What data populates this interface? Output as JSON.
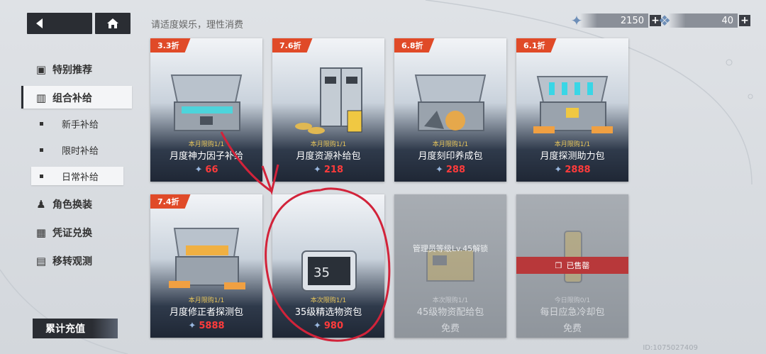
{
  "header": {
    "back_icon": "back-arrow-icon",
    "home_icon": "home-icon",
    "notice": "请适度娱乐，理性消费"
  },
  "currency": [
    {
      "icon": "crystal-gem-icon",
      "value": "2150",
      "plus": "+"
    },
    {
      "icon": "blue-gem-icon",
      "value": "40",
      "plus": "+"
    }
  ],
  "sidebar": {
    "items": [
      {
        "label": "特别推荐",
        "icon": "recommend-icon"
      },
      {
        "label": "组合补给",
        "icon": "supply-icon"
      },
      {
        "label": "角色换装",
        "icon": "costume-icon"
      },
      {
        "label": "凭证兑换",
        "icon": "voucher-icon"
      },
      {
        "label": "移转观测",
        "icon": "transfer-icon"
      }
    ],
    "sub_items": [
      {
        "label": "新手补给"
      },
      {
        "label": "限时补给"
      },
      {
        "label": "日常补给"
      }
    ],
    "recharge": "累计充值"
  },
  "cards": [
    {
      "discount": "3.3折",
      "limit": "本月限购1/1",
      "name": "月度神力因子补给",
      "price": "66"
    },
    {
      "discount": "7.6折",
      "limit": "本月限购1/1",
      "name": "月度资源补给包",
      "price": "218"
    },
    {
      "discount": "6.8折",
      "limit": "本月限购1/1",
      "name": "月度刻印养成包",
      "price": "288"
    },
    {
      "discount": "6.1折",
      "limit": "本月限购1/1",
      "name": "月度探测助力包",
      "price": "2888"
    },
    {
      "discount": "7.4折",
      "limit": "本月限购1/1",
      "name": "月度修正者探测包",
      "price": "5888"
    },
    {
      "discount": "",
      "limit": "本次限购1/1",
      "name": "35级精选物资包",
      "price": "980"
    },
    {
      "lock_text": "管理员等级Lv.45解锁",
      "limit": "本次限购1/1",
      "name": "45级物资配给包",
      "price": "免费"
    },
    {
      "sold_text": "已售罄",
      "limit": "今日限购0/1",
      "name": "每日应急冷却包",
      "price": "免费"
    }
  ],
  "footer": {
    "uid": "ID:1075027409"
  },
  "colors": {
    "discount": "#e04a28",
    "price": "#ff3b3b",
    "limit": "#e7c55a",
    "annotation": "#d2233a"
  }
}
